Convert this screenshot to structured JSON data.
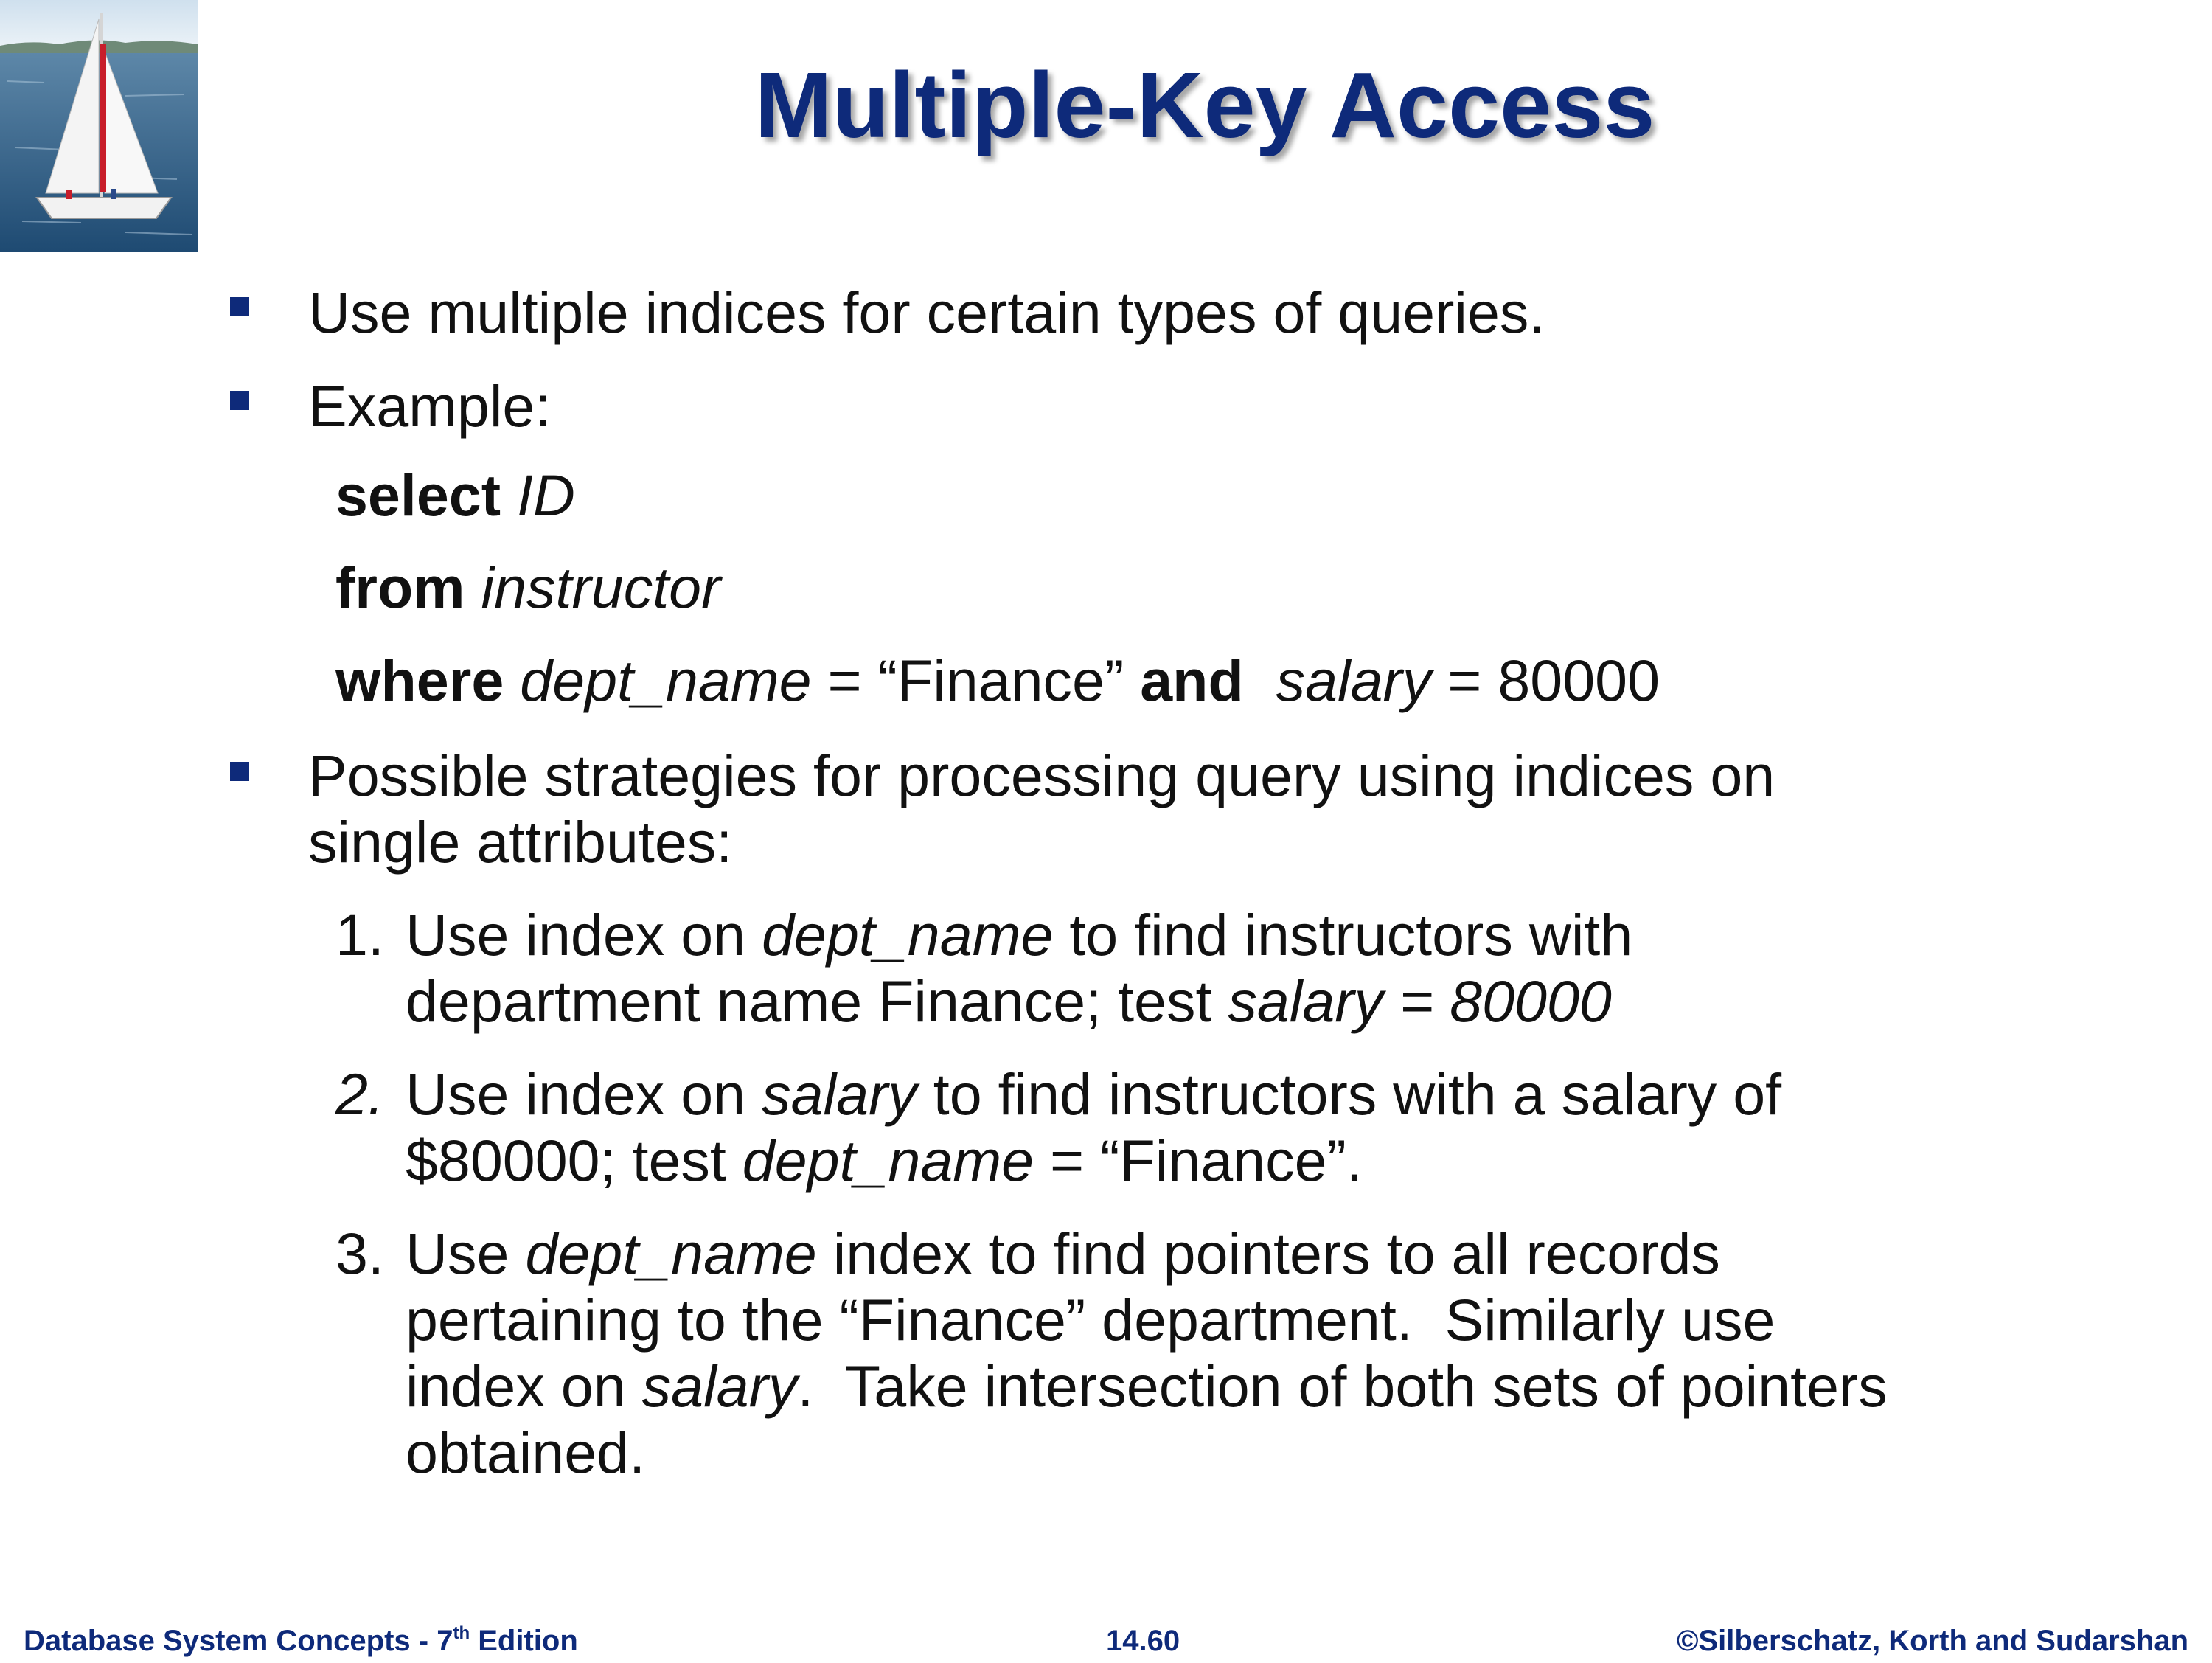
{
  "title": "Multiple-Key Access",
  "bullets": {
    "b1": "Use multiple indices for certain types of queries.",
    "b2": "Example:",
    "b3_line1": "Possible strategies for processing query using indices on",
    "b3_line2": "single attributes:"
  },
  "query": {
    "kw_select": "select",
    "attr_id": "ID",
    "kw_from": "from",
    "table": "instructor",
    "kw_where": "where",
    "attr_dept": "dept_name",
    "eq1": " = “Finance” ",
    "kw_and": "and",
    "attr_salary": "salary",
    "eq2": " = 80000"
  },
  "strategies": {
    "s1": {
      "num": "1.",
      "l1_a": "Use index on ",
      "l1_em": "dept_name",
      "l1_b": " to find instructors with",
      "l2_a": "department name Finance; test ",
      "l2_em": "salary = 80000"
    },
    "s2": {
      "num": "2.",
      "l1_a": "Use index on ",
      "l1_em": "salary",
      "l1_b": " to find instructors with a salary of",
      "l2_a": "$80000; test ",
      "l2_em": "dept_name",
      "l2_b": " = “Finance”."
    },
    "s3": {
      "num": "3.",
      "l1_a": "Use ",
      "l1_em": "dept_name",
      "l1_b": " index to find pointers to all records",
      "l2": "pertaining to the “Finance” department.  Similarly use",
      "l3_a": "index on ",
      "l3_em": "salary",
      "l3_b": ".  Take intersection of both sets of pointers",
      "l4": "obtained."
    }
  },
  "footer": {
    "left_text": "Database System Concepts - 7",
    "left_sup": "th",
    "left_tail": " Edition",
    "center": "14.60",
    "right": "©Silberschatz, Korth and Sudarshan"
  },
  "colors": {
    "accent": "#0e2a7a",
    "text": "#111111"
  },
  "logo_icon": "sailboat-image"
}
